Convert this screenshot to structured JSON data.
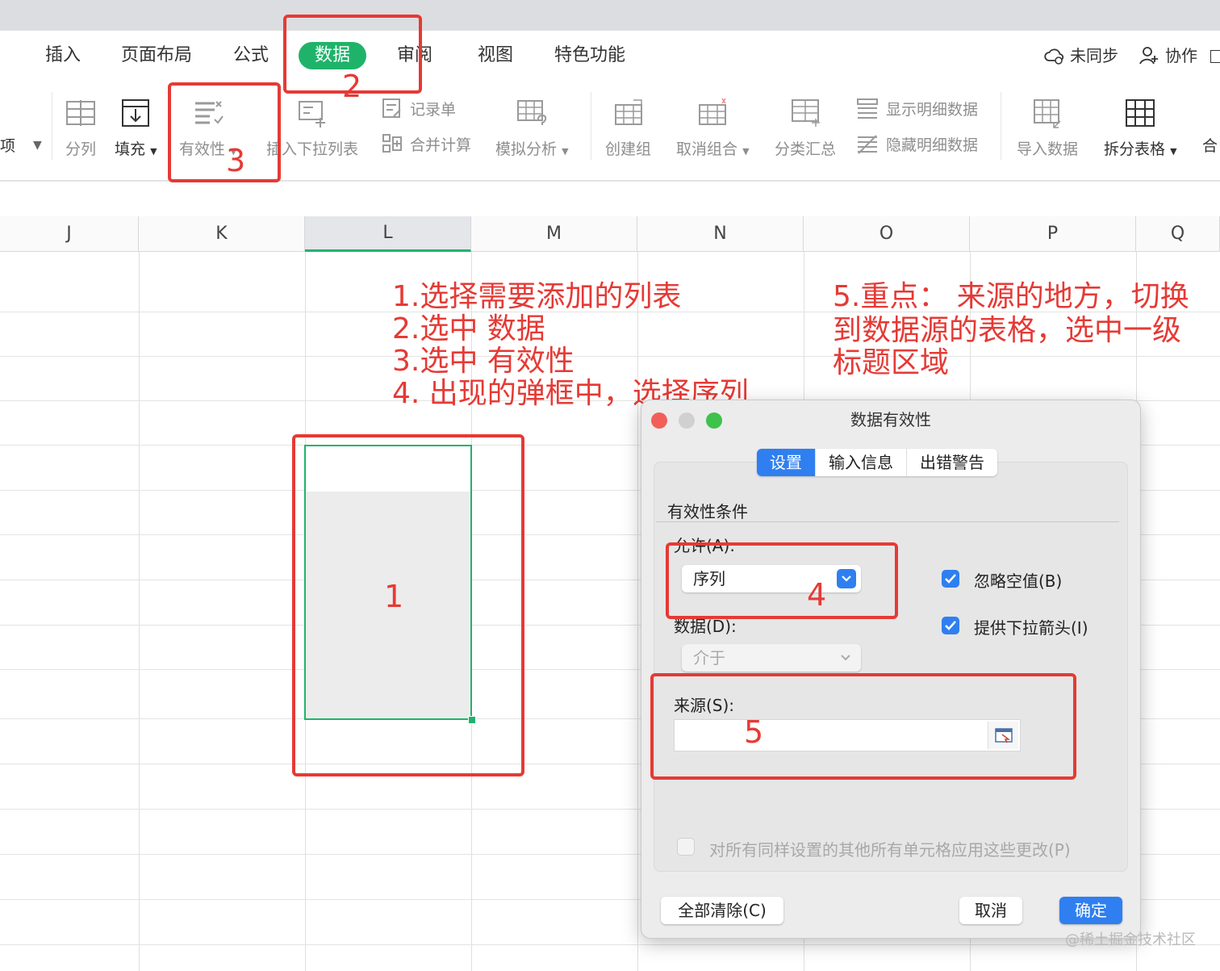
{
  "menu": {
    "tabs": [
      "插入",
      "页面布局",
      "公式",
      "数据",
      "审阅",
      "视图",
      "特色功能"
    ],
    "active": "数据",
    "sync": "未同步",
    "collab": "协作"
  },
  "ribbon": {
    "cut_item": "项",
    "split": "分列",
    "fill": "填充",
    "validity": "有效性",
    "insert_dropdown": "插入下拉列表",
    "record": "记录单",
    "consolidate": "合并计算",
    "simulate": "模拟分析",
    "create_group": "创建组",
    "ungroup": "取消组合",
    "subtotal": "分类汇总",
    "show_detail": "显示明细数据",
    "hide_detail": "隐藏明细数据",
    "import": "导入数据",
    "split_table": "拆分表格",
    "merge_cut": "合"
  },
  "grid": {
    "columns": [
      "J",
      "K",
      "L",
      "M",
      "N",
      "O",
      "P",
      "Q"
    ],
    "selected_column": "L"
  },
  "annotations": {
    "step_notes": [
      "1.选择需要添加的列表",
      "2.选中 数据",
      "3.选中 有效性",
      "4. 出现的弹框中，选择序列"
    ],
    "step5_note": [
      "5.重点： 来源的地方，切换",
      "到数据源的表格，选中一级",
      "标题区域"
    ],
    "num1": "1",
    "num2": "2",
    "num3": "3",
    "num4": "4",
    "num5": "5",
    "color": "#e53a35"
  },
  "dialog": {
    "title": "数据有效性",
    "tabs": [
      "设置",
      "输入信息",
      "出错警告"
    ],
    "active_tab": "设置",
    "section": "有效性条件",
    "allow_label": "允许(A):",
    "allow_value": "序列",
    "data_label": "数据(D):",
    "data_value": "介于",
    "ignore_blank": "忽略空值(B)",
    "dropdown_arrow": "提供下拉箭头(I)",
    "source_label": "来源(S):",
    "source_value": "",
    "apply_all": "对所有同样设置的其他所有单元格应用这些更改(P)",
    "clear_all": "全部清除(C)",
    "cancel": "取消",
    "ok": "确定"
  },
  "watermark": "@稀土掘金技术社区",
  "colors": {
    "accent_green": "#1fb36a",
    "accent_blue": "#2f7ff0",
    "annotation_red": "#e53a35"
  }
}
